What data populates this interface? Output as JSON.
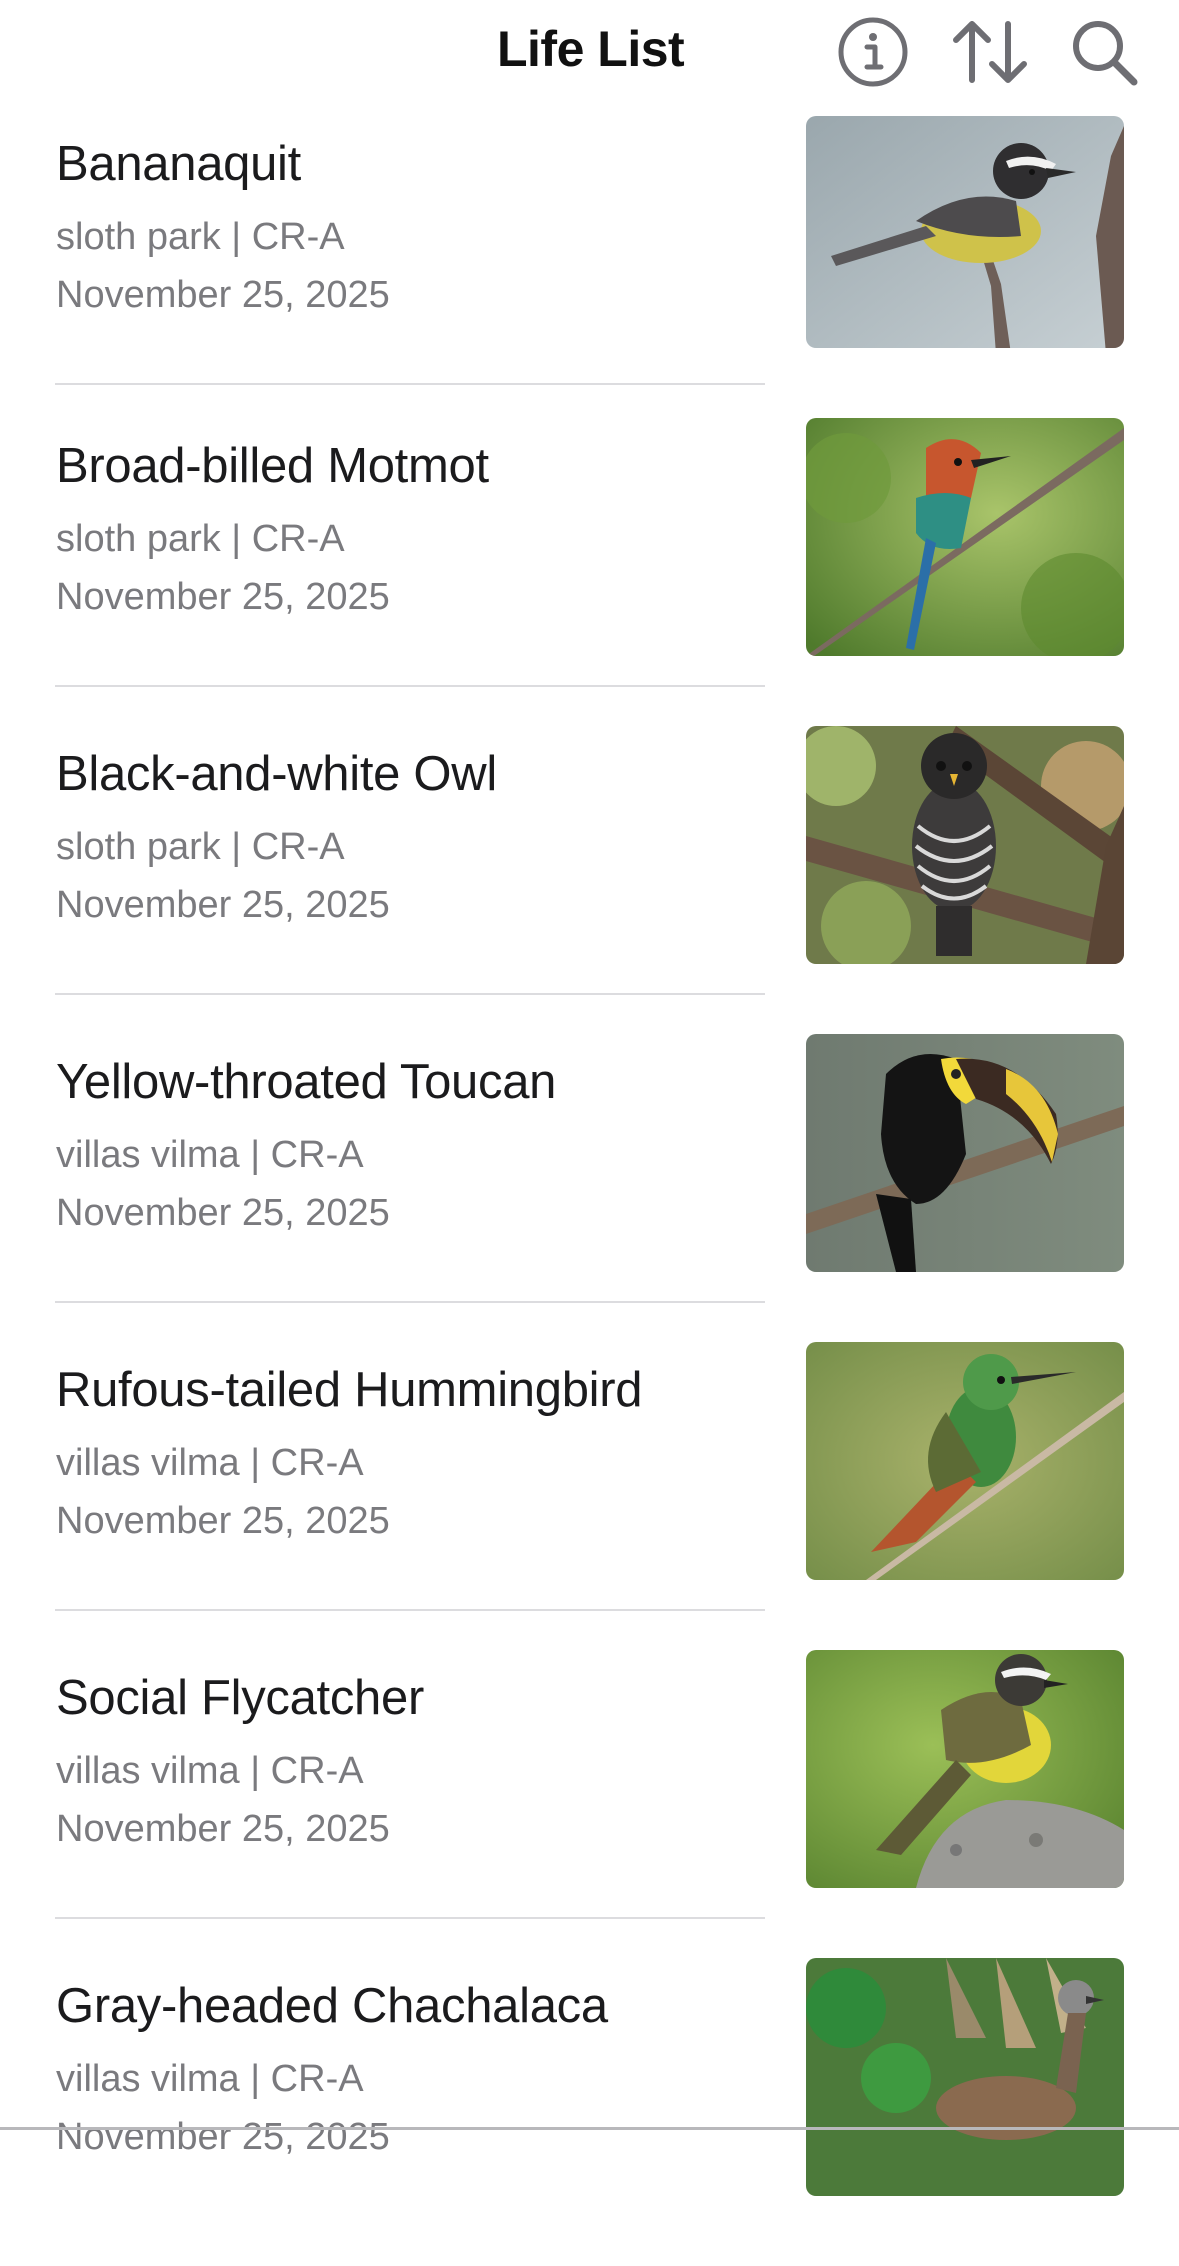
{
  "header": {
    "title": "Life List",
    "icons": [
      "info-icon",
      "sort-icon",
      "search-icon"
    ]
  },
  "colors": {
    "text_primary": "#1b1b1d",
    "text_secondary": "#7a7a7e",
    "divider": "#dcdcdf",
    "icon": "#6e6e73"
  },
  "sightings": [
    {
      "name": "Bananaquit",
      "location": "sloth park | CR-A",
      "date": "November 25, 2025"
    },
    {
      "name": "Broad-billed Motmot",
      "location": "sloth park | CR-A",
      "date": "November 25, 2025"
    },
    {
      "name": "Black-and-white Owl",
      "location": "sloth park | CR-A",
      "date": "November 25, 2025"
    },
    {
      "name": "Yellow-throated Toucan",
      "location": "villas vilma | CR-A",
      "date": "November 25, 2025"
    },
    {
      "name": "Rufous-tailed Hummingbird",
      "location": "villas vilma | CR-A",
      "date": "November 25, 2025"
    },
    {
      "name": "Social Flycatcher",
      "location": "villas vilma | CR-A",
      "date": "November 25, 2025"
    },
    {
      "name": "Gray-headed Chachalaca",
      "location": "villas vilma | CR-A",
      "date": "November 25, 2025"
    }
  ]
}
